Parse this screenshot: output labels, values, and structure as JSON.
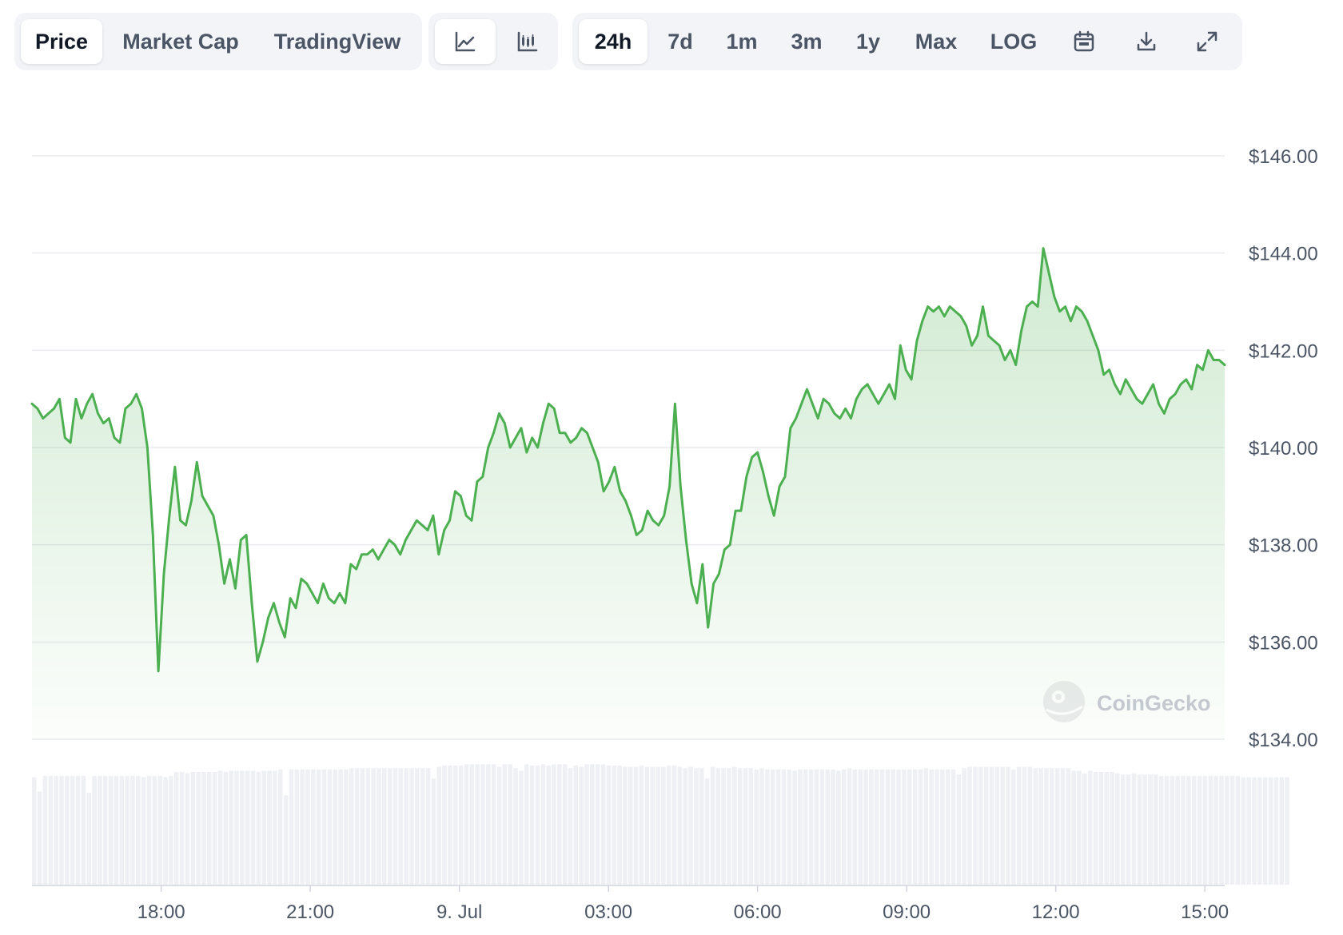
{
  "toolbar": {
    "data_tabs": [
      {
        "label": "Price",
        "active": true
      },
      {
        "label": "Market Cap",
        "active": false
      },
      {
        "label": "TradingView",
        "active": false
      }
    ],
    "chart_types": [
      {
        "icon": "line-chart-icon",
        "active": true
      },
      {
        "icon": "candlestick-chart-icon",
        "active": false
      }
    ],
    "ranges": [
      {
        "label": "24h",
        "active": true
      },
      {
        "label": "7d",
        "active": false
      },
      {
        "label": "1m",
        "active": false
      },
      {
        "label": "3m",
        "active": false
      },
      {
        "label": "1y",
        "active": false
      },
      {
        "label": "Max",
        "active": false
      },
      {
        "label": "LOG",
        "active": false
      }
    ],
    "actions": [
      {
        "icon": "calendar-icon"
      },
      {
        "icon": "download-icon"
      },
      {
        "icon": "expand-icon"
      }
    ]
  },
  "watermark": "CoinGecko",
  "colors": {
    "line": "#4caf50",
    "volume": "#eef0f4",
    "grid": "#eaecf0",
    "axis_text": "#4b5565"
  },
  "chart_data": {
    "type": "area",
    "x_start": "8 Jul 15:24",
    "x_end": "9 Jul 15:20",
    "x_ticks": [
      {
        "label": "18:00",
        "t": 2.6
      },
      {
        "label": "21:00",
        "t": 5.6
      },
      {
        "label": "9. Jul",
        "t": 8.6
      },
      {
        "label": "03:00",
        "t": 11.6
      },
      {
        "label": "06:00",
        "t": 14.6
      },
      {
        "label": "09:00",
        "t": 17.6
      },
      {
        "label": "12:00",
        "t": 20.6
      },
      {
        "label": "15:00",
        "t": 23.6
      }
    ],
    "y_ticks": [
      "$146.00",
      "$144.00",
      "$142.00",
      "$140.00",
      "$138.00",
      "$136.00",
      "$134.00"
    ],
    "ylim": [
      134,
      146
    ],
    "grid": true,
    "series": [
      {
        "values": [
          140.9,
          140.8,
          140.6,
          140.7,
          140.8,
          141.0,
          140.2,
          140.1,
          141.0,
          140.6,
          140.9,
          141.1,
          140.7,
          140.5,
          140.6,
          140.2,
          140.1,
          140.8,
          140.9,
          141.1,
          140.8,
          140.0,
          138.2,
          135.4,
          137.4,
          138.6,
          139.6,
          138.5,
          138.4,
          138.9,
          139.7,
          139.0,
          138.8,
          138.6,
          138.0,
          137.2,
          137.7,
          137.1,
          138.1,
          138.2,
          136.8,
          135.6,
          136.0,
          136.5,
          136.8,
          136.4,
          136.1,
          136.9,
          136.7,
          137.3,
          137.2,
          137.0,
          136.8,
          137.2,
          136.9,
          136.8,
          137.0,
          136.8,
          137.6,
          137.5,
          137.8,
          137.8,
          137.9,
          137.7,
          137.9,
          138.1,
          138.0,
          137.8,
          138.1,
          138.3,
          138.5,
          138.4,
          138.3,
          138.6,
          137.8,
          138.3,
          138.5,
          139.1,
          139.0,
          138.6,
          138.5,
          139.3,
          139.4,
          140.0,
          140.3,
          140.7,
          140.5,
          140.0,
          140.2,
          140.4,
          139.9,
          140.2,
          140.0,
          140.5,
          140.9,
          140.8,
          140.3,
          140.3,
          140.1,
          140.2,
          140.4,
          140.3,
          140.0,
          139.7,
          139.1,
          139.3,
          139.6,
          139.1,
          138.9,
          138.6,
          138.2,
          138.3,
          138.7,
          138.5,
          138.4,
          138.6,
          139.2,
          140.9,
          139.2,
          138.1,
          137.2,
          136.8,
          137.6,
          136.3,
          137.2,
          137.4,
          137.9,
          138.0,
          138.7,
          138.7,
          139.4,
          139.8,
          139.9,
          139.5,
          139.0,
          138.6,
          139.2,
          139.4,
          140.4,
          140.6,
          140.9,
          141.2,
          140.9,
          140.6,
          141.0,
          140.9,
          140.7,
          140.6,
          140.8,
          140.6,
          141.0,
          141.2,
          141.3,
          141.1,
          140.9,
          141.1,
          141.3,
          141.0,
          142.1,
          141.6,
          141.4,
          142.2,
          142.6,
          142.9,
          142.8,
          142.9,
          142.7,
          142.9,
          142.8,
          142.7,
          142.5,
          142.1,
          142.3,
          142.9,
          142.3,
          142.2,
          142.1,
          141.8,
          142.0,
          141.7,
          142.4,
          142.9,
          143.0,
          142.9,
          144.1,
          143.6,
          143.1,
          142.8,
          142.9,
          142.6,
          142.9,
          142.8,
          142.6,
          142.3,
          142.0,
          141.5,
          141.6,
          141.3,
          141.1,
          141.4,
          141.2,
          141.0,
          140.9,
          141.1,
          141.3,
          140.9,
          140.7,
          141.0,
          141.1,
          141.3,
          141.4,
          141.2,
          141.7,
          141.6,
          142.0,
          141.8,
          141.8,
          141.7
        ],
        "volume": [
          0.83,
          0.72,
          0.84,
          0.84,
          0.84,
          0.84,
          0.84,
          0.84,
          0.84,
          0.84,
          0.71,
          0.84,
          0.84,
          0.84,
          0.84,
          0.84,
          0.84,
          0.84,
          0.84,
          0.84,
          0.83,
          0.84,
          0.84,
          0.84,
          0.83,
          0.84,
          0.87,
          0.87,
          0.86,
          0.87,
          0.87,
          0.87,
          0.87,
          0.87,
          0.88,
          0.87,
          0.88,
          0.88,
          0.88,
          0.88,
          0.88,
          0.87,
          0.88,
          0.88,
          0.88,
          0.89,
          0.69,
          0.89,
          0.89,
          0.89,
          0.89,
          0.89,
          0.89,
          0.89,
          0.89,
          0.89,
          0.89,
          0.89,
          0.9,
          0.9,
          0.9,
          0.9,
          0.9,
          0.9,
          0.9,
          0.9,
          0.9,
          0.9,
          0.9,
          0.9,
          0.9,
          0.9,
          0.9,
          0.82,
          0.91,
          0.92,
          0.92,
          0.92,
          0.92,
          0.93,
          0.93,
          0.93,
          0.93,
          0.93,
          0.93,
          0.91,
          0.93,
          0.93,
          0.9,
          0.88,
          0.93,
          0.92,
          0.92,
          0.93,
          0.92,
          0.93,
          0.93,
          0.93,
          0.9,
          0.92,
          0.91,
          0.93,
          0.93,
          0.93,
          0.93,
          0.92,
          0.92,
          0.92,
          0.91,
          0.91,
          0.91,
          0.92,
          0.91,
          0.91,
          0.91,
          0.91,
          0.92,
          0.92,
          0.91,
          0.9,
          0.91,
          0.9,
          0.9,
          0.82,
          0.91,
          0.9,
          0.9,
          0.9,
          0.91,
          0.9,
          0.9,
          0.9,
          0.89,
          0.9,
          0.89,
          0.89,
          0.89,
          0.89,
          0.89,
          0.88,
          0.89,
          0.89,
          0.89,
          0.89,
          0.89,
          0.89,
          0.89,
          0.88,
          0.89,
          0.9,
          0.89,
          0.89,
          0.89,
          0.89,
          0.89,
          0.89,
          0.89,
          0.89,
          0.89,
          0.89,
          0.89,
          0.89,
          0.89,
          0.9,
          0.89,
          0.89,
          0.89,
          0.89,
          0.89,
          0.85,
          0.9,
          0.91,
          0.91,
          0.91,
          0.91,
          0.91,
          0.91,
          0.91,
          0.91,
          0.89,
          0.91,
          0.91,
          0.91,
          0.9,
          0.9,
          0.9,
          0.9,
          0.9,
          0.9,
          0.9,
          0.88,
          0.88,
          0.86,
          0.88,
          0.87,
          0.87,
          0.87,
          0.87,
          0.86,
          0.85,
          0.85,
          0.86,
          0.85,
          0.85,
          0.85,
          0.85,
          0.84,
          0.84,
          0.84,
          0.84,
          0.84,
          0.84,
          0.84,
          0.84,
          0.84,
          0.84,
          0.84,
          0.84,
          0.84,
          0.84,
          0.84,
          0.83,
          0.83,
          0.83,
          0.83,
          0.83,
          0.83,
          0.83,
          0.83,
          0.83
        ]
      }
    ]
  }
}
